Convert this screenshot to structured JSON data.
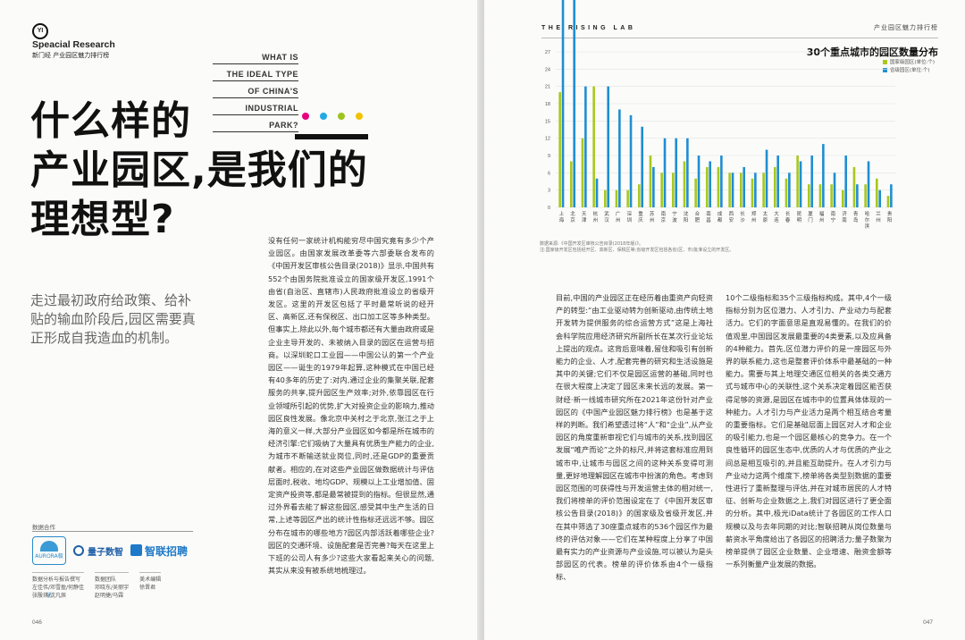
{
  "left_page": {
    "logo_mark": "YI",
    "section_title": "Speacial Research",
    "section_sub": "新门经 产业园区魅力排行榜",
    "eng_question": [
      "WHAT IS",
      "THE IDEAL TYPE",
      "OF CHINA'S",
      "INDUSTRIAL",
      "PARK?"
    ],
    "dot_colors": [
      "#e6007e",
      "#22a9e6",
      "#9dc41b",
      "#f2c200"
    ],
    "headline": [
      "什么样的",
      "产业园区,是我们的",
      "理想型?"
    ],
    "dek": "走过最初政府给政策、给补贴的输血阶段后,园区需要真正形成自我造血的机制。",
    "col1": "没有任何一家统计机构能穷尽中国究竟有多少个产业园区。由国家发展改革委等六部委联合发布的《中国开发区审核公告目录(2018)》显示,中国共有552个由国务院批准设立的国家级开发区,1991个由省(自治区、直辖市)人民政府批准设立的省级开发区。这里的开发区包括了平时最常听说的经开区、高新区,还有保税区、出口加工区等多种类型。但事实上,除此以外,每个城市都还有大量由政府或是企业主导开发的、未被纳入目录的园区在运营与招商。以深圳蛇口工业园——中国公认的第一个产业园区——诞生的1979年起算,这种模式在中国已经有40多年的历史了:对内,通过企业的集聚关联,配套服务的共享,提升园区生产效率;对外,依靠园区在行业领域所引起的优势,扩大对投资企业的影响力,推动园区良性发展。像北京中关村之于北京,张江之于上海的意义一样,大部分产业园区如今都是所在城市的经济引擎:它们吸纳了大量具有优质生产能力的企业,为城市不断输送就业岗位,同时,还是GDP的重要贡献者。相应的,在对这些产业园区做数据统计与评估层面时,税收、地均GDP、规模以上工业增加值、固定资产投资等,都是最常被提到的指标。但很显然,通过外界看去能了解这些园区,感受其中生产生活的日常,上述等园区产出的统计性指标还远远不够。园区分布在城市的哪些地方?园区内部活跃着哪些企业?园区的交通环境、设施配套是否完善?每天在这里上下班的公司人有多少?这些大家看起来关心的问题,其实从来没有被系统地梳理过。",
    "partner_label": "数据合作",
    "partner_logos": [
      "AURORA极光",
      "量子数智",
      "智联招聘"
    ],
    "credits": [
      [
        "数据分析与报告撰写",
        "左佳伟/邓雪盈/何静佳",
        "张殷琪/沈凡辰"
      ],
      [
        "数据团队",
        "邓晓东/吴丽宇",
        "赵明捷/马霖"
      ],
      [
        "美术编辑",
        "徐晋君"
      ]
    ],
    "page_number": "046"
  },
  "right_page": {
    "rising_lab": "THE RISING LAB",
    "ranking_header": "产业园区魅力排行榜",
    "page_number": "047",
    "col1": "目前,中国的产业园区正在经历着由重资产向轻资产的转型:“由工业驱动转为创新驱动,由传统土地开发转为提供服务的综合运营方式”这是上海社会科学院应用经济研究所副所长在某次行业论坛上提出的观点。这背后意味着,留住和吸引有创新能力的企业、人才,配套完善的研究和生活设施是其中的关键;它们不仅是园区运营的基础,同时也在很大程度上决定了园区未来长远的发展。第一财经·新一线城市研究所在2021年这份针对产业园区的《中国产业园区魅力排行榜》也是基于这样的判断。我们希望透过将“人”和“企业”,从产业园区的角度重新审视它们与城市的关系,找到园区发展“唯产而论”之外的标尺,并将这套标准应用到城市中,让城市与园区之间的这种关系变得可测量,更好地理解园区在城市中扮演的角色。考虑到园区范围的可获得性与开发运营主体的相对统一,我们将榜单的评价范围设定在了《中国开发区审核公告目录(2018)》的国家级及省级开发区,并在其中筛选了30座重点城市的536个园区作为最终的评估对象——它们在某种程度上分享了中国最有实力的产业资源与产业设施,可以被认为是头部园区的代表。榜单的评价体系由4个一级指标、",
    "col2": "10个二级指标和35个三级指标构成。其中,4个一级指标分别为区位潜力、人才引力、产业动力与配套活力。它们的字面意思是直观易懂的。在我们的价值观里,中国园区发展最重要的4类要素,以及应具备的4种能力。首先,区位潜力评价的是一座园区与外界的联系能力,这也是整套评价体系中最基础的一种能力。需要与其上地理交通区位相关的各类交通方式与城市中心的关联性,这个关系决定着园区能否获得足够的资源,是园区在城市中的位置具体体现的一种能力。人才引力与产业活力是两个相互结合考量的重要指标。它们是基础层面上园区对人才和企业的吸引能力,也是一个园区最核心的竞争力。在一个良性循环的园区生态中,优质的人才与优质的产业之间总是相互吸引的,并且能互助提升。在人才引力与产业动力这两个维度下,榜单将各类型别数据的重要性进行了重新整理与评估,并在对城市居民的人才特征、创新与企业数据之上,我们对园区进行了更全面的分析。其中,极光iData统计了各园区的工作人口规模以及与去年同期的对比;智联招聘从岗位数量与薪资水平角度给出了各园区的招聘活力;量子数聚为榜单提供了园区企业数量、企业增速、融资金额等一系列衡量产业发展的数据。"
  },
  "chart_data": {
    "type": "bar",
    "title": "30个重点城市的园区数量分布",
    "legend": [
      "国家级园区(单位:个)",
      "省级园区(单位:个)"
    ],
    "colors": [
      "#a8c81e",
      "#1f8ed2"
    ],
    "yticks": [
      0,
      3,
      6,
      9,
      12,
      15,
      18,
      21,
      24,
      27,
      30,
      33,
      36
    ],
    "ylim": [
      0,
      36
    ],
    "categories": [
      "上海",
      "北京",
      "天津",
      "杭州",
      "武汉",
      "广州",
      "深圳",
      "重庆",
      "苏州",
      "南京",
      "宁波",
      "沈阳",
      "合肥",
      "南昌",
      "成都",
      "西安",
      "长沙",
      "郑州",
      "太原",
      "大连",
      "长春",
      "昆明",
      "厦门",
      "福州",
      "南宁",
      "济南",
      "青岛",
      "哈尔滨",
      "兰州",
      "贵阳"
    ],
    "series": [
      {
        "name": "国家级园区(单位:个)",
        "values": [
          20,
          8,
          12,
          21,
          3,
          3,
          3,
          4,
          9,
          6,
          6,
          8,
          5,
          7,
          7,
          6,
          6,
          5,
          6,
          7,
          5,
          9,
          4,
          4,
          4,
          3,
          7,
          4,
          5,
          2
        ]
      },
      {
        "name": "省级园区(单位:个)",
        "values": [
          36,
          37,
          21,
          5,
          21,
          17,
          16,
          14,
          7,
          12,
          12,
          12,
          9,
          8,
          9,
          6,
          7,
          6,
          10,
          9,
          6,
          8,
          9,
          11,
          6,
          9,
          4,
          8,
          3,
          4
        ]
      }
    ],
    "note_lines": [
      "数据来源:《中国开发区审核公告目录(2018年版)》。",
      "注:国家级开发区包括经开区、高新区、保税区等;省级开发区包括各省(区、市)批准设立的开发区。"
    ]
  }
}
